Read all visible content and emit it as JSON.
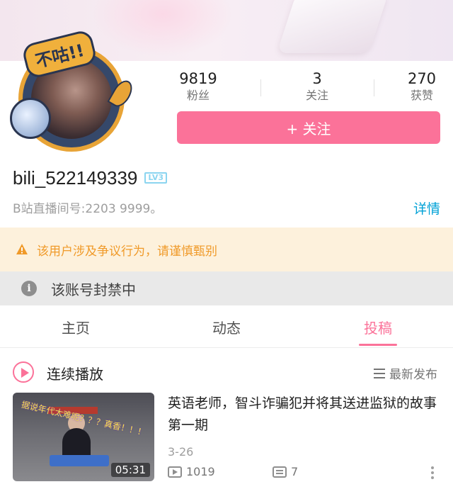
{
  "profile": {
    "avatar_stamp": "不咕!!",
    "stats": [
      {
        "value": "9819",
        "label": "粉丝"
      },
      {
        "value": "3",
        "label": "关注"
      },
      {
        "value": "270",
        "label": "获赞"
      }
    ],
    "follow_label": "+ 关注",
    "username": "bili_522149339",
    "level_badge": "LV3",
    "live_room": "B站直播间号:2203  9999。",
    "detail_link": "详情"
  },
  "warning": {
    "text": "该用户涉及争议行为，请谨慎甄别",
    "icon": "warning-triangle-icon",
    "color": "#f09a29"
  },
  "banned": {
    "text": "该账号封禁中",
    "icon": "info-icon"
  },
  "tabs": [
    {
      "label": "主页",
      "active": false
    },
    {
      "label": "动态",
      "active": false
    },
    {
      "label": "投稿",
      "active": true
    }
  ],
  "playlist": {
    "label": "连续播放",
    "sort_label": "最新发布"
  },
  "videos": [
    {
      "title": "英语老师，智斗诈骗犯并将其送进监狱的故事  第一期",
      "thumbnail_caption": "据说年代太难呢？？？真香！！！",
      "duration": "05:31",
      "date": "3-26",
      "views": "1019",
      "danmaku": "7"
    }
  ],
  "colors": {
    "accent": "#fb7299",
    "link": "#00a1d6",
    "warning_bg": "#fdf1dc"
  }
}
